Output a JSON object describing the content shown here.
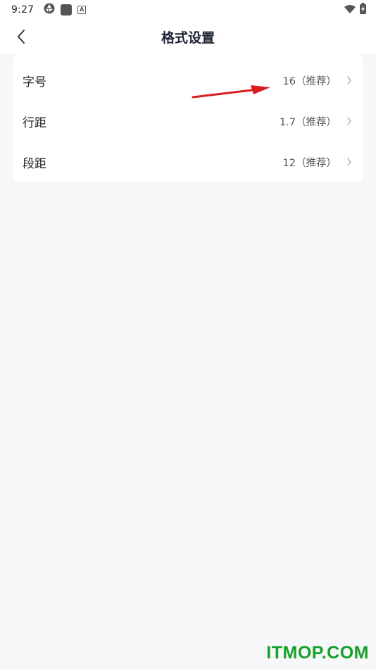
{
  "status_bar": {
    "time": "9:27",
    "icons": [
      "aperture-icon",
      "square-app-icon",
      "a-badge-icon",
      "wifi-icon",
      "battery-charging-icon"
    ]
  },
  "header": {
    "title": "格式设置",
    "back_icon": "chevron-left-icon"
  },
  "settings": {
    "items": [
      {
        "label": "字号",
        "value": "16（推荐）"
      },
      {
        "label": "行距",
        "value": "1.7（推荐）"
      },
      {
        "label": "段距",
        "value": "12（推荐）"
      }
    ]
  },
  "annotation": {
    "icon": "red-arrow-icon",
    "color": "#d81e1e"
  },
  "watermark": {
    "text": "ITMOP.COM",
    "color": "#17a02a"
  }
}
